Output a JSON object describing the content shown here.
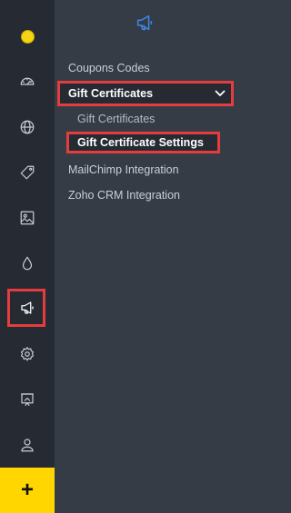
{
  "rail": {
    "items": [
      {
        "icon": "status-dot-icon"
      },
      {
        "icon": "speedometer-icon"
      },
      {
        "icon": "globe-icon"
      },
      {
        "icon": "tag-icon"
      },
      {
        "icon": "image-icon"
      },
      {
        "icon": "drop-icon"
      },
      {
        "icon": "megaphone-icon"
      },
      {
        "icon": "gear-icon"
      },
      {
        "icon": "presentation-icon"
      },
      {
        "icon": "user-icon"
      }
    ],
    "add_label": "+",
    "accent_color": "#ffd600",
    "highlight_color": "#e53d3d"
  },
  "panel": {
    "header_icon": "megaphone-icon",
    "items": [
      {
        "label": "Coupons Codes"
      },
      {
        "label": "Gift Certificates"
      },
      {
        "label": "MailChimp Integration"
      },
      {
        "label": "Zoho CRM Integration"
      }
    ],
    "sub_items": [
      {
        "label": "Gift Certificates"
      },
      {
        "label": "Gift Certificate Settings"
      }
    ]
  }
}
